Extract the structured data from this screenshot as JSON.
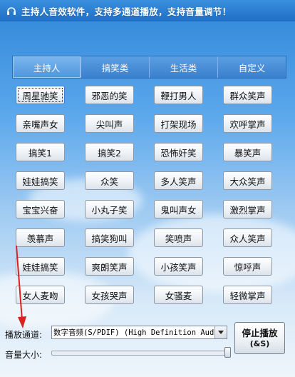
{
  "window": {
    "title": "主持人音效软件，支持多通道播放，支持音量调节！",
    "icon": "headphones-icon"
  },
  "tabs": [
    {
      "label": "主持人",
      "active": true
    },
    {
      "label": "搞笑类",
      "active": false
    },
    {
      "label": "生活类",
      "active": false
    },
    {
      "label": "自定义",
      "active": false
    }
  ],
  "sounds": [
    [
      "周星驰笑",
      "邪恶的笑",
      "鞭打男人",
      "群众笑声"
    ],
    [
      "亲嘴声女",
      "尖叫声",
      "打架现场",
      "欢呼掌声"
    ],
    [
      "搞笑1",
      "搞笑2",
      "恐怖奸笑",
      "暴笑声"
    ],
    [
      "娃娃搞笑",
      "众笑",
      "多人笑声",
      "大众笑声"
    ],
    [
      "宝宝兴奋",
      "小丸子笑",
      "鬼叫声女",
      "激烈掌声"
    ],
    [
      "羡慕声",
      "搞笑狗叫",
      "笑喷声",
      "众人笑声"
    ],
    [
      "娃娃搞笑",
      "爽朗笑声",
      "小孩笑声",
      "惊呼声"
    ],
    [
      "女人麦吻",
      "女孩哭声",
      "女骚麦",
      "轻微掌声"
    ]
  ],
  "controls": {
    "channel_label": "播放通道:",
    "channel_value": "数字音频(S/PDIF) (High Definition Audio",
    "volume_label": "音量大小:",
    "volume_level": 1.0,
    "stop_label": "停止播放",
    "stop_shortcut": "(&S)"
  },
  "colors": {
    "annotation_arrow": "#d92121",
    "tab_bar": "#3a7fcd",
    "title_bar": "#1f6fc6"
  }
}
